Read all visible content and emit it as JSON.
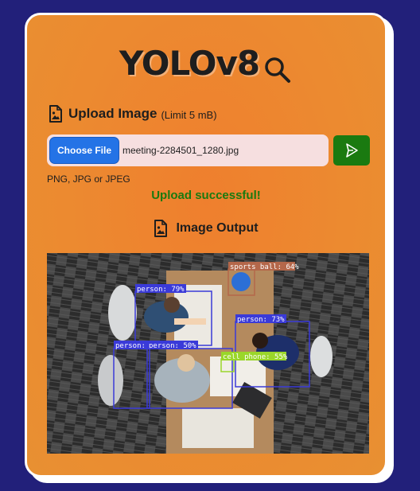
{
  "app": {
    "title": "YOLOv8"
  },
  "upload": {
    "heading": "Upload Image",
    "limit": "(Limit 5 mB)",
    "choose_file_label": "Choose File",
    "file_name": "meeting-2284501_1280.jpg",
    "hint": "PNG, JPG or JPEG",
    "status": "Upload successful!"
  },
  "output": {
    "heading": "Image Output",
    "detections": [
      {
        "label": "sports ball: 64%",
        "color": "#b4674a"
      },
      {
        "label": "person: 79%",
        "color": "#3a3ad8"
      },
      {
        "label": "person: 73%",
        "color": "#3a3ad8"
      },
      {
        "label": "person: 50%",
        "color": "#3a3ad8"
      },
      {
        "label": "person:",
        "color": "#3a3ad8"
      },
      {
        "label": "cell phone: 55%",
        "color": "#9ad62a"
      }
    ]
  },
  "colors": {
    "background": "#22207a",
    "card": "#ec8a30",
    "choose_button": "#2473e6",
    "submit_button": "#1a7a10",
    "success_text": "#1a7a10"
  },
  "icons": {
    "title": "search-icon",
    "upload": "image-file-icon",
    "submit": "send-icon",
    "output": "image-file-icon"
  }
}
